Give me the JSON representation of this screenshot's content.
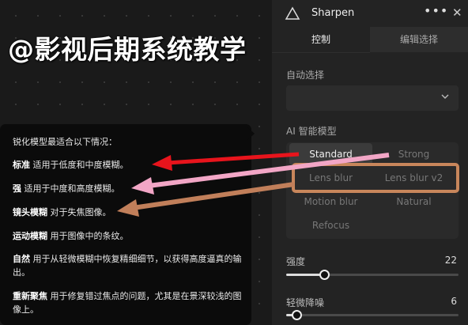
{
  "watermark": "@影视后期系统教学",
  "panel": {
    "title": "Sharpen",
    "tabs": [
      "控制",
      "编辑选择"
    ],
    "auto_select_label": "自动选择",
    "auto_select_value": "",
    "ai_model_label": "AI 智能模型",
    "models": [
      "Standard",
      "Strong",
      "Lens blur",
      "Lens blur v2",
      "Motion blur",
      "Natural",
      "Refocus"
    ],
    "selected_model": "Standard",
    "sliders": [
      {
        "label": "强度",
        "value": "22",
        "level": 22
      },
      {
        "label": "轻微降噪",
        "value": "6",
        "level": 6
      }
    ]
  },
  "tooltip": {
    "intro": "锐化模型最适合以下情况：",
    "items": [
      {
        "term": "标准",
        "desc": " 适用于低度和中度模糊。"
      },
      {
        "term": "强",
        "desc": " 适用于中度和高度模糊。"
      },
      {
        "term": "镜头模糊",
        "desc": " 对于失焦图像。"
      },
      {
        "term": "运动模糊",
        "desc": " 用于图像中的条纹。"
      },
      {
        "term": "自然",
        "desc": " 用于从轻微模糊中恢复精细细节，以获得高度逼真的输出。"
      },
      {
        "term": "重新聚焦",
        "desc": " 用于修复错过焦点的问题，尤其是在景深较浅的图像上。"
      }
    ]
  },
  "annotation_colors": {
    "red": "#e8141c",
    "pink": "#f2a6c6",
    "brown": "#c17f5a",
    "highlight_box": "#c8865b"
  }
}
